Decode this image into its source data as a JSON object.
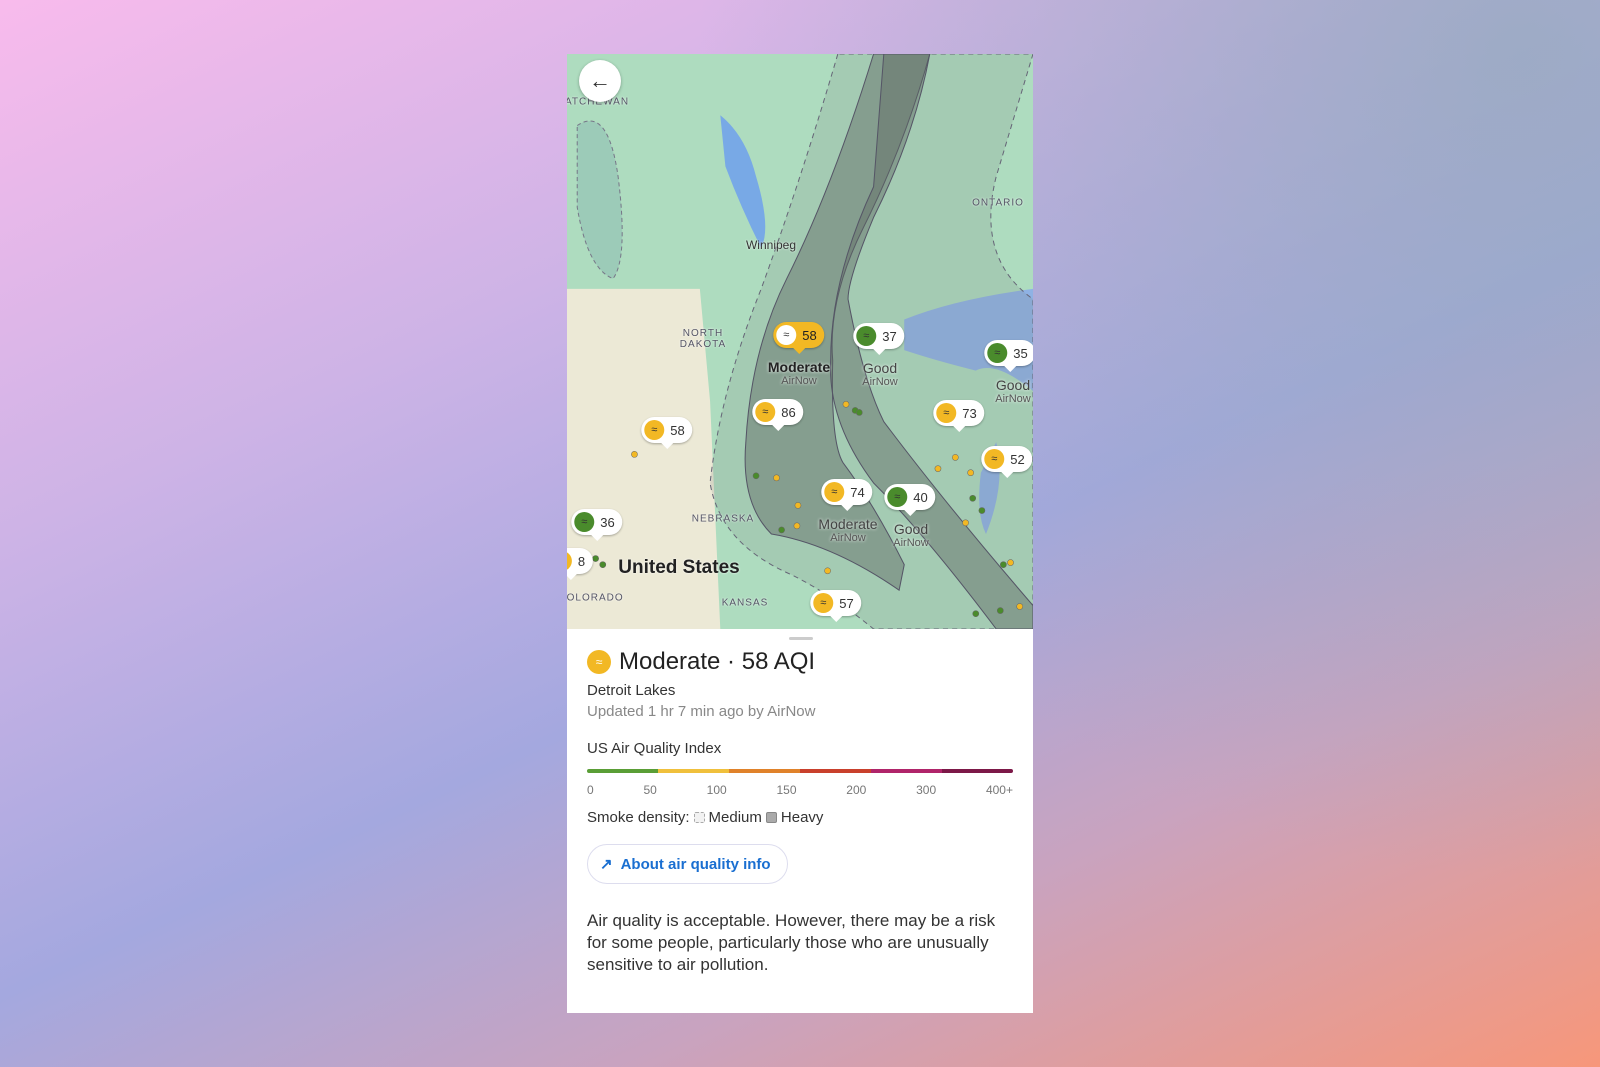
{
  "map": {
    "places": [
      {
        "text": "ATCHEWAN",
        "kind": "region",
        "pos": "a"
      },
      {
        "text": "Winnipeg",
        "kind": "city"
      },
      {
        "text": "ONTARIO",
        "kind": "region"
      },
      {
        "text": "NORTH\nDAKOTA",
        "kind": "region"
      },
      {
        "text": "NEBRASKA",
        "kind": "region"
      },
      {
        "text": "United States",
        "kind": "country"
      },
      {
        "text": "COLORADO",
        "kind": "region"
      },
      {
        "text": "KANSAS",
        "kind": "region"
      }
    ],
    "markers": [
      {
        "aqi": "58",
        "level": "moderate",
        "selected": true,
        "category": "Moderate",
        "source": "AirNow"
      },
      {
        "aqi": "37",
        "level": "good",
        "category": "Good",
        "source": "AirNow"
      },
      {
        "aqi": "35",
        "level": "good",
        "category": "Good",
        "source": "AirNow"
      },
      {
        "aqi": "86",
        "level": "moderate"
      },
      {
        "aqi": "58",
        "level": "moderate"
      },
      {
        "aqi": "73",
        "level": "moderate"
      },
      {
        "aqi": "52",
        "level": "moderate"
      },
      {
        "aqi": "74",
        "level": "moderate",
        "category": "Moderate",
        "source": "AirNow"
      },
      {
        "aqi": "40",
        "level": "good",
        "category": "Good",
        "source": "AirNow"
      },
      {
        "aqi": "36",
        "level": "good"
      },
      {
        "aqi": "8",
        "level": "moderate"
      },
      {
        "aqi": "57",
        "level": "moderate"
      }
    ],
    "colors": {
      "good": "#4a8b2c",
      "moderate": "#f2b824"
    }
  },
  "back_icon": "arrow-left-icon",
  "sheet": {
    "title": "Moderate · 58 AQI",
    "location": "Detroit Lakes",
    "updated": "Updated 1 hr 7 min ago by AirNow",
    "index_label": "US Air Quality Index",
    "scale_colors": [
      "#5a9e36",
      "#f0c03c",
      "#e0822a",
      "#c9402c",
      "#b0246a",
      "#7c1848"
    ],
    "ticks": [
      "0",
      "50",
      "100",
      "150",
      "200",
      "300",
      "400+"
    ],
    "smoke_label": "Smoke density:",
    "smoke_medium": "Medium",
    "smoke_heavy": "Heavy",
    "about_button": "About air quality info",
    "description": "Air quality is acceptable. However, there may be a risk for some people, particularly those who are unusually sensitive to air pollution."
  }
}
